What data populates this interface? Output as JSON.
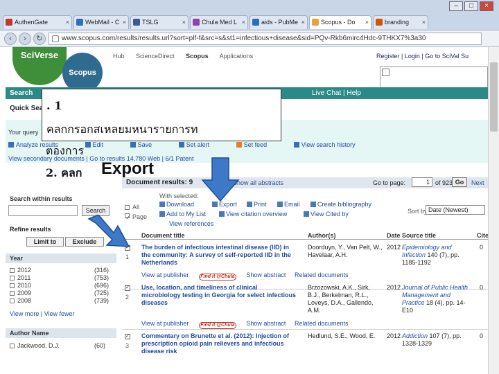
{
  "browser": {
    "tabs": [
      {
        "label": "AuthenGate",
        "color": "#c0392b"
      },
      {
        "label": "WebMail - C",
        "color": "#2e6fba"
      },
      {
        "label": "TSLG",
        "color": "#3b5998"
      },
      {
        "label": "Chula Med L",
        "color": "#8e44ad"
      },
      {
        "label": "aids - PubMe",
        "color": "#2a6ebb"
      },
      {
        "label": "Scopus - Do",
        "color": "#e8a13a"
      },
      {
        "label": "branding",
        "color": "#d35400"
      }
    ],
    "url": "www.scopus.com/results/results.url?sort=plf-f&src=s&st1=infectious+disease&sid=PQv-Rkb6mirc4Hdc-9THKX7%3a30"
  },
  "header": {
    "logo_sciverse": "SciVerse",
    "logo_scopus": "Scopus",
    "nav": [
      "Hub",
      "ScienceDirect",
      "Scopus",
      "Applications"
    ],
    "account_links": "Register  |  Login  |  Go to SciVal Su"
  },
  "greenbar": {
    "search_tab": "Search",
    "right_links": "Live Chat  |  Help"
  },
  "quick_search": "Quick Sea",
  "query": {
    "label": "Your query",
    "toolbar": [
      "Analyze results",
      "Edit",
      "Save",
      "Set alert",
      "Set feed",
      "View search history"
    ],
    "secondary": "View secondary documents  |  Go to results 14,780 Web  |  6/1 Patent"
  },
  "left": {
    "search_within_title": "Search within results",
    "search_button": "Search",
    "refine_title": "Refine results",
    "limit_to": "Limit to",
    "exclude": "Exclude",
    "year_facet": {
      "title": "Year",
      "rows": [
        {
          "label": "2012",
          "count": "(316)"
        },
        {
          "label": "2011",
          "count": "(753)"
        },
        {
          "label": "2010",
          "count": "(696)"
        },
        {
          "label": "2009",
          "count": "(725)"
        },
        {
          "label": "2008",
          "count": "(739)"
        }
      ],
      "more": "View more | View fewer"
    },
    "author_facet": {
      "title": "Author Name",
      "rows": [
        {
          "label": "Jackwood, D.J.",
          "count": "(60)"
        }
      ]
    }
  },
  "results": {
    "title": "Document results: 9",
    "show_all": "Show all abstracts",
    "goto_label": "Go to page:",
    "page": "1",
    "of_pages": "of 923",
    "go": "Go",
    "next": "Next",
    "select_all": "All",
    "select_page": "Page",
    "with_selected": "With selected:",
    "actions": [
      "Download",
      "Export",
      "Print",
      "Email",
      "Create bibliography",
      "Add to My List",
      "View citation overview",
      "View Cited by",
      "View references"
    ],
    "sort_label": "Sort by",
    "sort_value": "Date (Newest)",
    "columns": [
      "Document title",
      "Author(s)",
      "Date",
      "Source title",
      "Cited"
    ],
    "rows": [
      {
        "num": "1",
        "title": "The burden of infectious intestinal disease (IID) in the community: A survey of self-reported IID in the Netherlands",
        "authors": "Doorduyn, Y., Van Pelt, W., Havelaar, A.H.",
        "year": "2012",
        "source": "Epidemiology and Infection",
        "details": "140 (7), pp. 1185-1192",
        "cited": "0",
        "links": "View at publisher",
        "find": "Find it @Chula",
        "show_abstract": "Show abstract",
        "related": "Related documents"
      },
      {
        "num": "2",
        "title": "Use, location, and timeliness of clinical microbiology testing in Georgia for select infectious diseases",
        "authors": "Brzozowski, A.K., Sirk, B.J., Berkelman, R.L., Loveys, D.A., Gallendo, A.M.",
        "year": "2012",
        "source": "Journal of Public Health Management and Practice",
        "details": "18 (4), pp. 14-E10",
        "cited": "0",
        "links": "View at publisher",
        "find": "Find it @Chula",
        "show_abstract": "Show abstract",
        "related": "Related documents"
      },
      {
        "num": "3",
        "title": "Commentary on Brunette et al. (2012): Injection of prescription opioid pain relievers and infectious disease risk",
        "authors": "Hedlund, S.E., Wood, E.",
        "year": "2012",
        "source": "Addiction",
        "details": "107 (7), pp. 1328-1329",
        "cited": "0"
      }
    ]
  },
  "callout": {
    "line1": ". 1",
    "line2": "คลกกรอกสเหลยมหนารายการท",
    "line3": "ตองการ",
    "line4": "2. คลก",
    "export": "Export"
  },
  "colors": {
    "arrow": "#3e78c8",
    "greenbar": "#2b8a88",
    "query_bg": "#e5f7f4"
  }
}
